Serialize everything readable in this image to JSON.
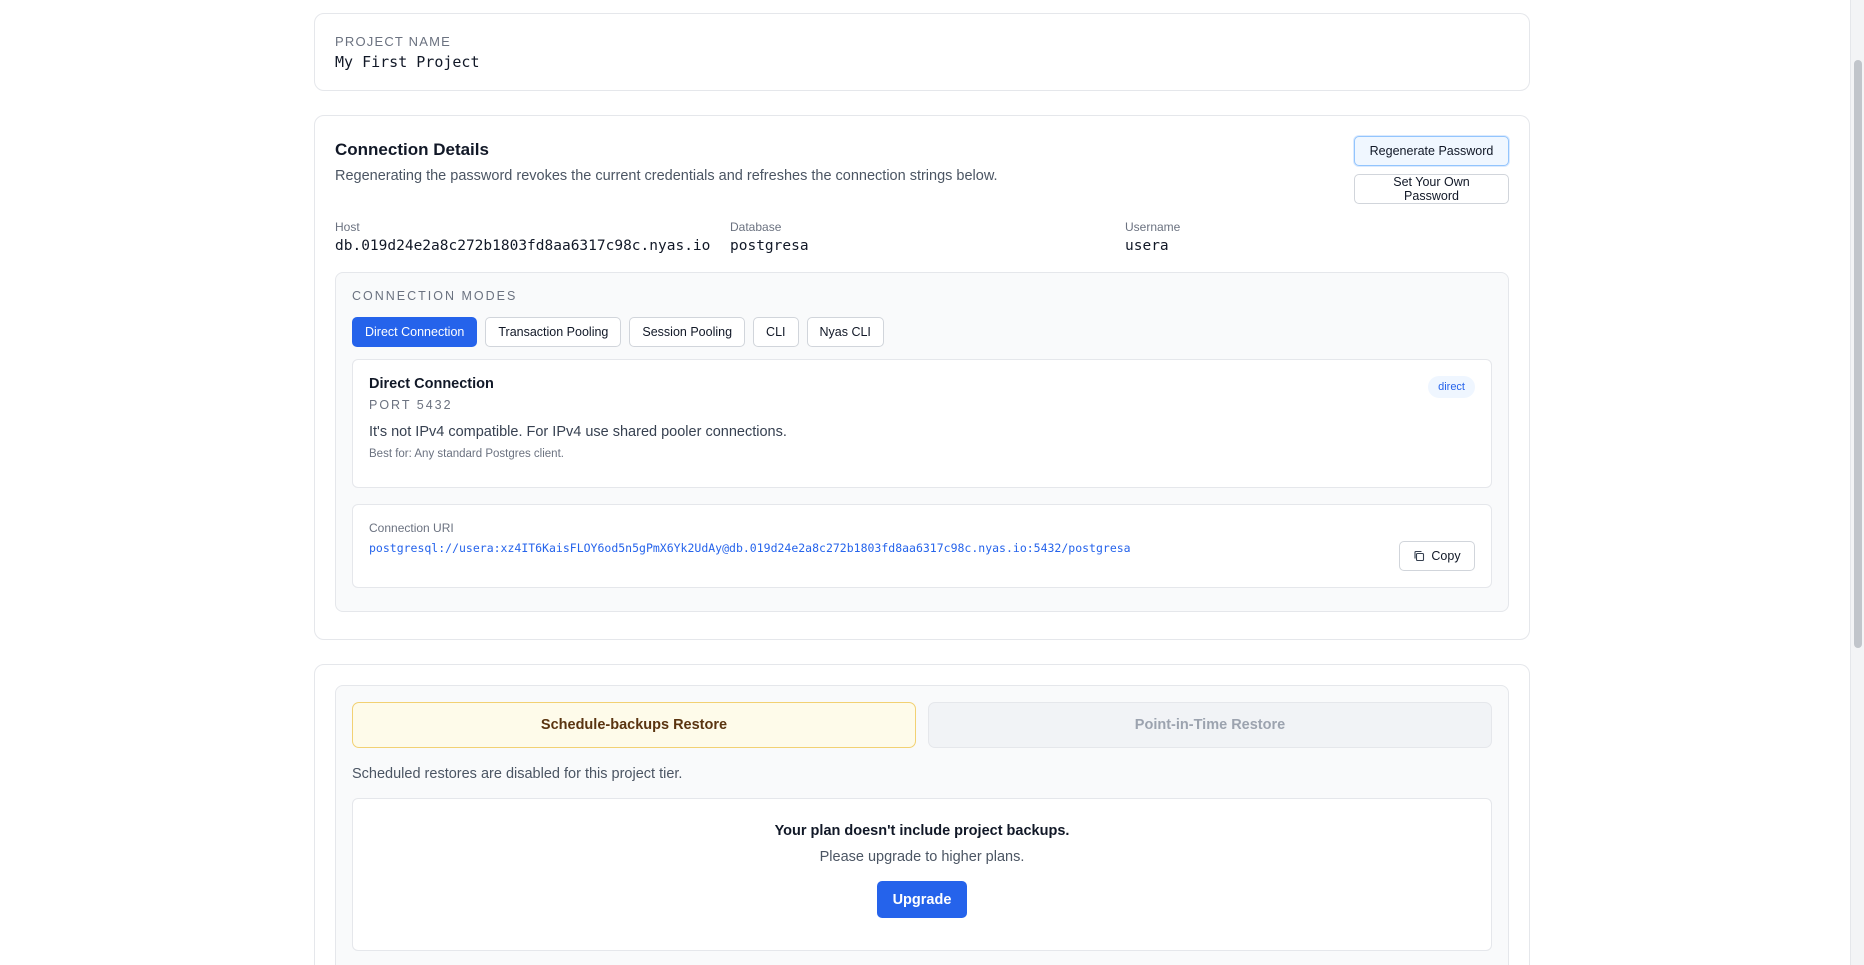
{
  "project": {
    "label": "PROJECT NAME",
    "value": "My First Project"
  },
  "connection": {
    "title": "Connection Details",
    "subtitle": "Regenerating the password revokes the current credentials and refreshes the connection strings below.",
    "regenerate_label": "Regenerate Password",
    "set_own_label": "Set Your Own Password",
    "host_label": "Host",
    "host_value": "db.019d24e2a8c272b1803fd8aa6317c98c.nyas.io",
    "database_label": "Database",
    "database_value": "postgresa",
    "username_label": "Username",
    "username_value": "usera",
    "modes_label": "CONNECTION MODES",
    "tabs": [
      {
        "label": "Direct Connection",
        "active": true
      },
      {
        "label": "Transaction Pooling",
        "active": false
      },
      {
        "label": "Session Pooling",
        "active": false
      },
      {
        "label": "CLI",
        "active": false
      },
      {
        "label": "Nyas CLI",
        "active": false
      }
    ],
    "mode": {
      "title": "Direct Connection",
      "port": "PORT 5432",
      "badge": "direct",
      "description": "It's not IPv4 compatible. For IPv4 use shared pooler connections.",
      "best_for": "Best for: Any standard Postgres client."
    },
    "uri": {
      "label": "Connection URI",
      "value": "postgresql://usera:xz4IT6KaisFLOY6od5n5gPmX6Yk2UdAy@db.019d24e2a8c272b1803fd8aa6317c98c.nyas.io:5432/postgresa",
      "copy_label": "Copy"
    }
  },
  "restore": {
    "tabs": [
      {
        "label": "Schedule-backups Restore",
        "active": true
      },
      {
        "label": "Point-in-Time Restore",
        "active": false
      }
    ],
    "note": "Scheduled restores are disabled for this project tier.",
    "plan_title": "Your plan doesn't include project backups.",
    "plan_sub": "Please upgrade to higher plans.",
    "upgrade_label": "Upgrade"
  },
  "colors": {
    "primary": "#2563eb",
    "active_restore_bg": "#fefbea",
    "active_restore_border": "#f2d173"
  }
}
